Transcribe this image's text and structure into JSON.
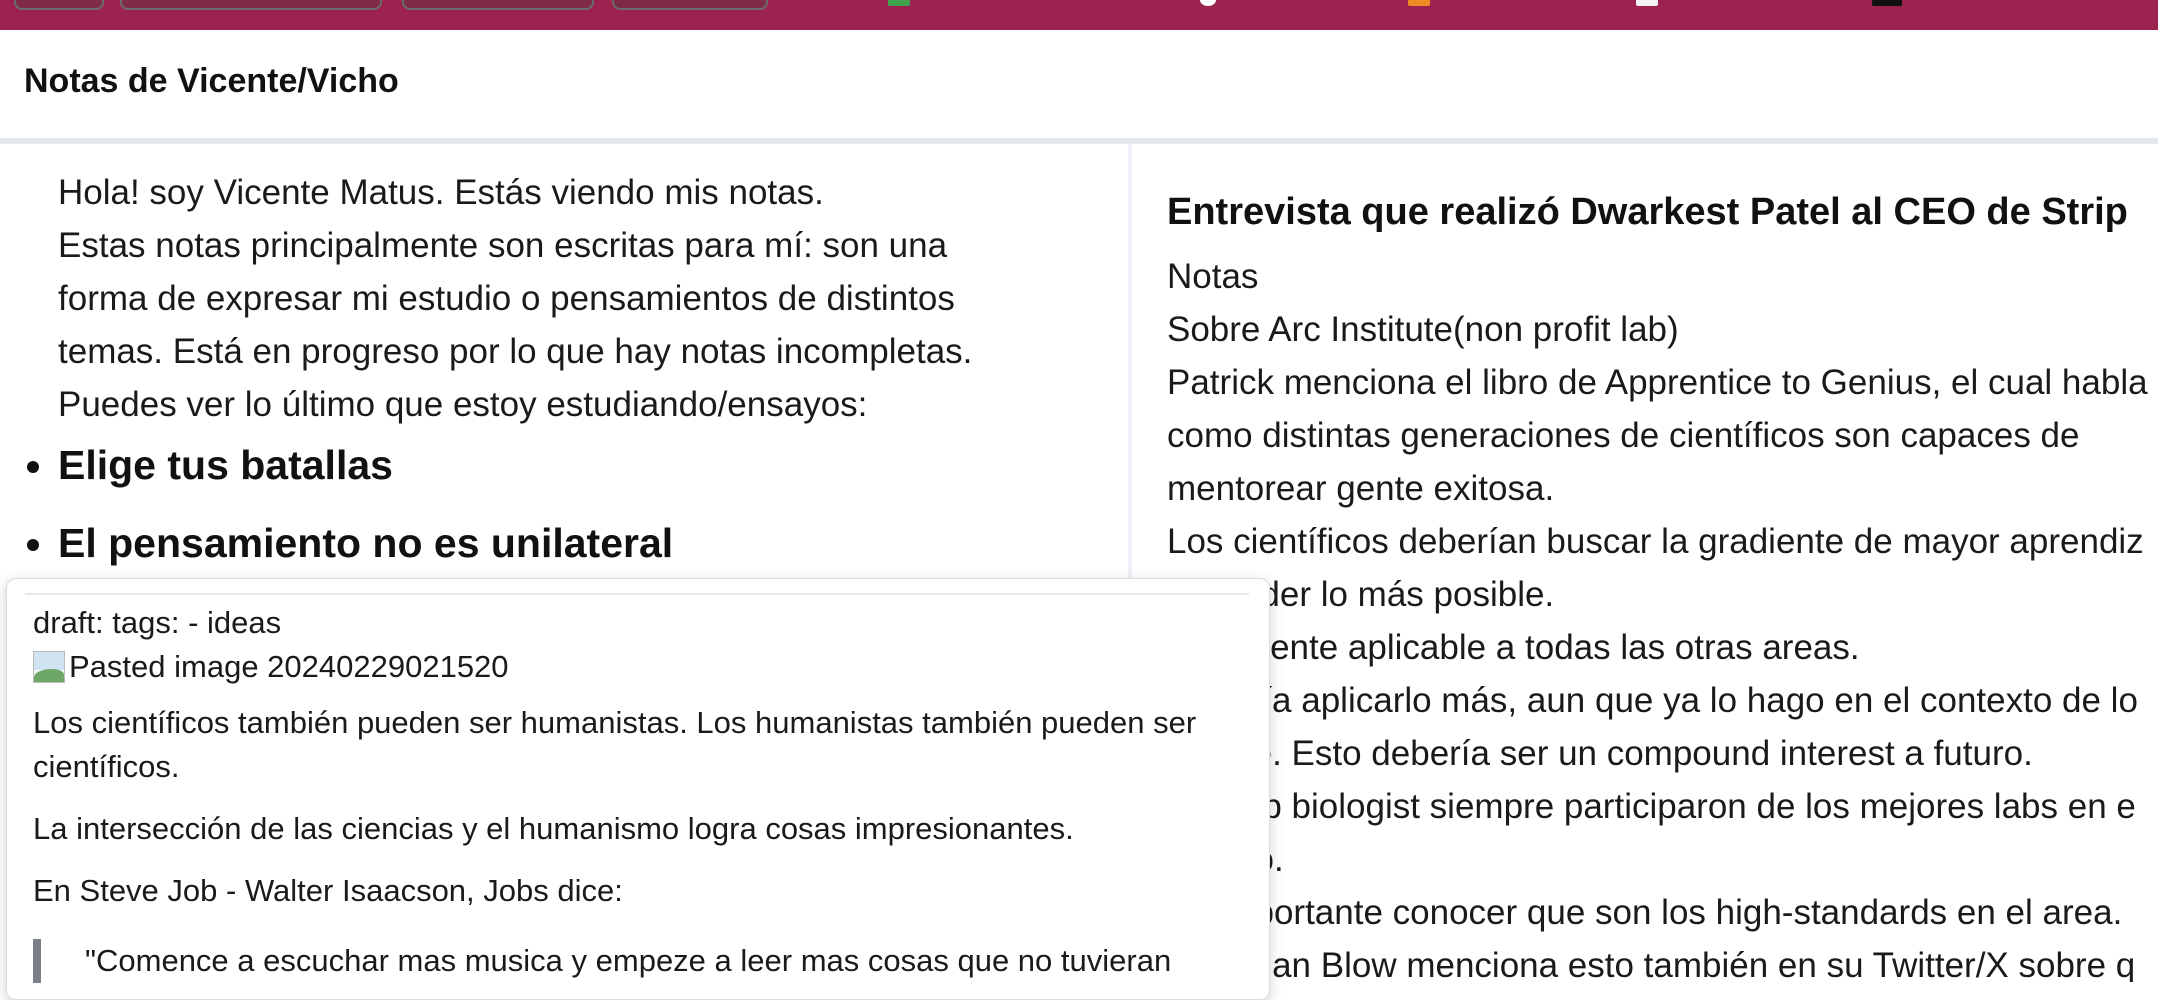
{
  "site": {
    "title": "Notas de Vicente/Vicho"
  },
  "intro": {
    "lines": [
      "Hola! soy Vicente Matus. Estás viendo mis notas.",
      "Estas notas principalmente son escritas para mí: son una",
      "forma de expresar mi estudio o pensamientos de distintos",
      "temas. Está en progreso por lo que hay notas incompletas.",
      "Puedes ver lo último que estoy estudiando/ensayos:"
    ]
  },
  "notes": [
    {
      "label": "Elige tus batallas"
    },
    {
      "label": "El pensamiento no es unilateral"
    }
  ],
  "preview": {
    "frontmatter": "draft: tags: - ideas",
    "image_alt": "Pasted image 20240229021520",
    "paragraphs": [
      "Los científicos también pueden ser humanistas. Los humanistas también pueden ser",
      "científicos.",
      "La intersección de las ciencias y el humanismo logra cosas impresionantes.",
      "En Steve Job - Walter Isaacson, Jobs dice:"
    ],
    "quote": "\"Comence a escuchar mas musica y empeze a leer mas cosas que no tuvieran"
  },
  "article": {
    "title": "Entrevista que realizó Dwarkest Patel al CEO de Strip",
    "lines": [
      "Notas",
      "Sobre Arc Institute(non profit lab)",
      "Patrick menciona el libro de Apprentice to Genius, el cual habla",
      "como distintas generaciones de científicos son capaces de",
      "mentorear gente exitosa.",
      "Los científicos deberían buscar la gradiente de mayor aprendiz",
      "Aprender lo más posible.",
      "Totalmente aplicable a todas las otras areas.",
      "Debería aplicarlo más, aun que ya lo hago en el contexto de lo",
      "que se. Esto debería ser un compound interest a futuro.",
      "Los top biologist siempre participaron de los mejores labs en e",
      "mundo.",
      "Es importante conocer que son los high-standards en el area.",
      "Jonathan Blow menciona esto también en su Twitter/X sobre q"
    ]
  },
  "colors": {
    "browser_bar": "#9c2350",
    "divider": "#e3e8ee",
    "quote_border": "#7a7f88"
  }
}
